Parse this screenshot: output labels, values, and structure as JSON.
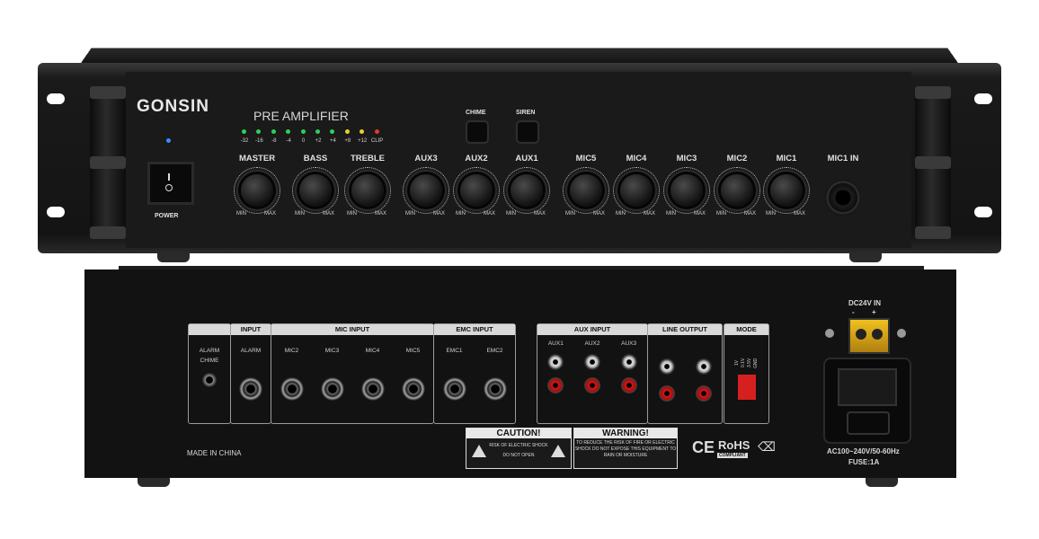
{
  "front": {
    "brand": "GONSIN",
    "model": "PRE AMPLIFIER",
    "led_labels": [
      "-32",
      "-16",
      "-8",
      "-4",
      "0",
      "+2",
      "+4",
      "+8",
      "+12",
      "CLIP"
    ],
    "led_colors": [
      "#2fd05a",
      "#2fd05a",
      "#2fd05a",
      "#2fd05a",
      "#2fd05a",
      "#2fd05a",
      "#2fd05a",
      "#e8d02a",
      "#e8d02a",
      "#e23a2a"
    ],
    "power_led_color": "#3a8cff",
    "power_label": "POWER",
    "chime_label": "CHIME",
    "siren_label": "SIREN",
    "knobs": [
      "MASTER",
      "BASS",
      "TREBLE",
      "AUX3",
      "AUX2",
      "AUX1",
      "MIC5",
      "MIC4",
      "MIC3",
      "MIC2",
      "MIC1"
    ],
    "min_label": "MIN",
    "max_label": "MAX",
    "mic1in_label": "MIC1 IN"
  },
  "rear": {
    "alarm_label": "ALARM",
    "chime_label": "CHIME",
    "input_header": "INPUT",
    "input_alarm": "ALARM",
    "mic_header": "MIC INPUT",
    "mic_labels": [
      "MIC2",
      "MIC3",
      "MIC4",
      "MIC5"
    ],
    "emc_header": "EMC INPUT",
    "emc_labels": [
      "EMC1",
      "EMC2"
    ],
    "aux_header": "AUX INPUT",
    "aux_labels": [
      "AUX1",
      "AUX2",
      "AUX3"
    ],
    "line_header": "LINE OUTPUT",
    "mode_header": "MODE",
    "mode_labels": [
      "1V",
      "0.1V",
      "3.5V",
      "GND"
    ],
    "made_in": "MADE IN CHINA",
    "caution_title": "CAUTION!",
    "caution_line1": "RISK OF ELECTRIC SHOCK",
    "caution_line2": "DO NOT OPEN",
    "warning_title": "WARNING!",
    "warning_line1": "TO REDUCE THE RISK OF FIRE OR ELECTRIC",
    "warning_line2": "SHOCK DO NOT EXPOSE THIS EQUIPMENT TO",
    "warning_line3": "RAIN OR MOISTURE",
    "ce_mark": "CE",
    "rohs": "RoHS",
    "rohs_sub": "COMPLIANT",
    "dc_label": "DC24V IN",
    "dc_minus": "-",
    "dc_plus": "+",
    "ac_label": "AC100~240V/50-60Hz",
    "fuse_label": "FUSE:1A"
  }
}
